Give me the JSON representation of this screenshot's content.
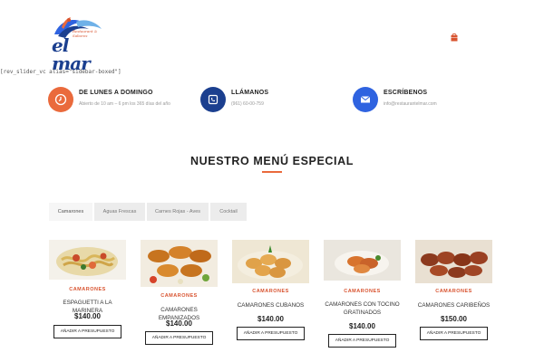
{
  "header": {
    "logo_name": "el mar",
    "logo_tagline": "Restaurant & Sabores",
    "cart_icon": "shopping-bag-icon"
  },
  "shortcode_text": "[rev_slider_vc alias=\"sidebar-boxed\"]",
  "info_blocks": [
    {
      "icon": "clock-icon",
      "color": "#ea6a3c",
      "title": "DE LUNES A DOMINGO",
      "description": "Abierto de 10 am – 6 pm los 365 días del año"
    },
    {
      "icon": "phone-icon",
      "color": "#1b3f8f",
      "title": "LLÁMANOS",
      "description": "(961) 60-00-759"
    },
    {
      "icon": "mail-icon",
      "color": "#2f63e0",
      "title": "ESCRÍBENOS",
      "description": "info@restaurantelmar.com"
    }
  ],
  "menu_section": {
    "title": "NUESTRO MENÚ ESPECIAL",
    "accent_color": "#ea6a3c"
  },
  "tabs": [
    {
      "label": "Camarones",
      "active": true
    },
    {
      "label": "Aguas Frescas",
      "active": false
    },
    {
      "label": "Carnes Rojas - Aves",
      "active": false
    },
    {
      "label": "Cocktail",
      "active": false
    }
  ],
  "products": [
    {
      "category": "CAMARONES",
      "name": "ESPAGUETTI A LA MARINERA",
      "price": "$140.00",
      "button": "AÑADIR A PRESUPUESTO"
    },
    {
      "category": "CAMARONES",
      "name": "CAMARONES EMPANIZADOS",
      "price": "$140.00",
      "button": "AÑADIR A PRESUPUESTO"
    },
    {
      "category": "CAMARONES",
      "name": "CAMARONES CUBANOS",
      "price": "$140.00",
      "button": "AÑADIR A PRESUPUESTO"
    },
    {
      "category": "CAMARONES",
      "name": "CAMARONES CON TOCINO GRATINADOS",
      "price": "$140.00",
      "button": "AÑADIR A PRESUPUESTO"
    },
    {
      "category": "CAMARONES",
      "name": "CAMARONES CARIBEÑOS",
      "price": "$150.00",
      "button": "AÑADIR A PRESUPUESTO"
    }
  ]
}
